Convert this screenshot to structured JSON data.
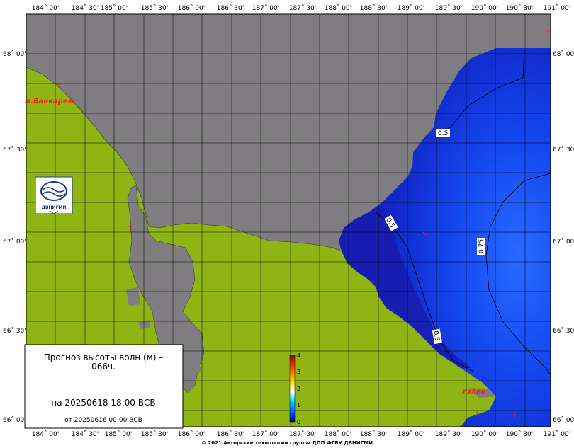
{
  "title_box": {
    "title": "Прогноз высоты волн (м) – 066ч.",
    "valid_time": "на 20250618 18:00 ВСВ",
    "base_time": "от 20250616 00:00 ВСВ"
  },
  "axes": {
    "x_ticks": [
      "184˚ 00'",
      "184˚ 30'",
      "185˚ 00'",
      "185˚ 30'",
      "186˚ 00'",
      "186˚ 30'",
      "187˚ 00'",
      "187˚ 30'",
      "188˚ 00'",
      "188˚ 30'",
      "189˚ 00'",
      "189˚ 30'",
      "190˚ 00'",
      "190˚ 30'",
      "191˚ 00'"
    ],
    "y_ticks": [
      "68˚ 00'",
      "67˚ 30'",
      "67˚ 00'",
      "66˚ 30'",
      "66˚ 00'"
    ]
  },
  "places": {
    "vankarem": "м.Ванкарем",
    "uelen": "Уэлен"
  },
  "contours": {
    "c1": "0.5",
    "c2": "0.5",
    "c3": "0.5",
    "c4": "0.75"
  },
  "colorbar": {
    "ticks": [
      "4",
      "3",
      "2",
      "1",
      "0"
    ],
    "range": [
      0,
      4
    ]
  },
  "logo": {
    "text": "ДВНИГМИ"
  },
  "footer": {
    "copyright": "© 2021 Авторские технологии группы ДПП ФГБУ ДВНИГМИ"
  },
  "colors": {
    "land": "#8fb514",
    "ice": "#7f7d7f",
    "sea_deep": "#1a1aa0",
    "sea_mid": "#1036e0",
    "sea_light": "#1d5af5"
  }
}
